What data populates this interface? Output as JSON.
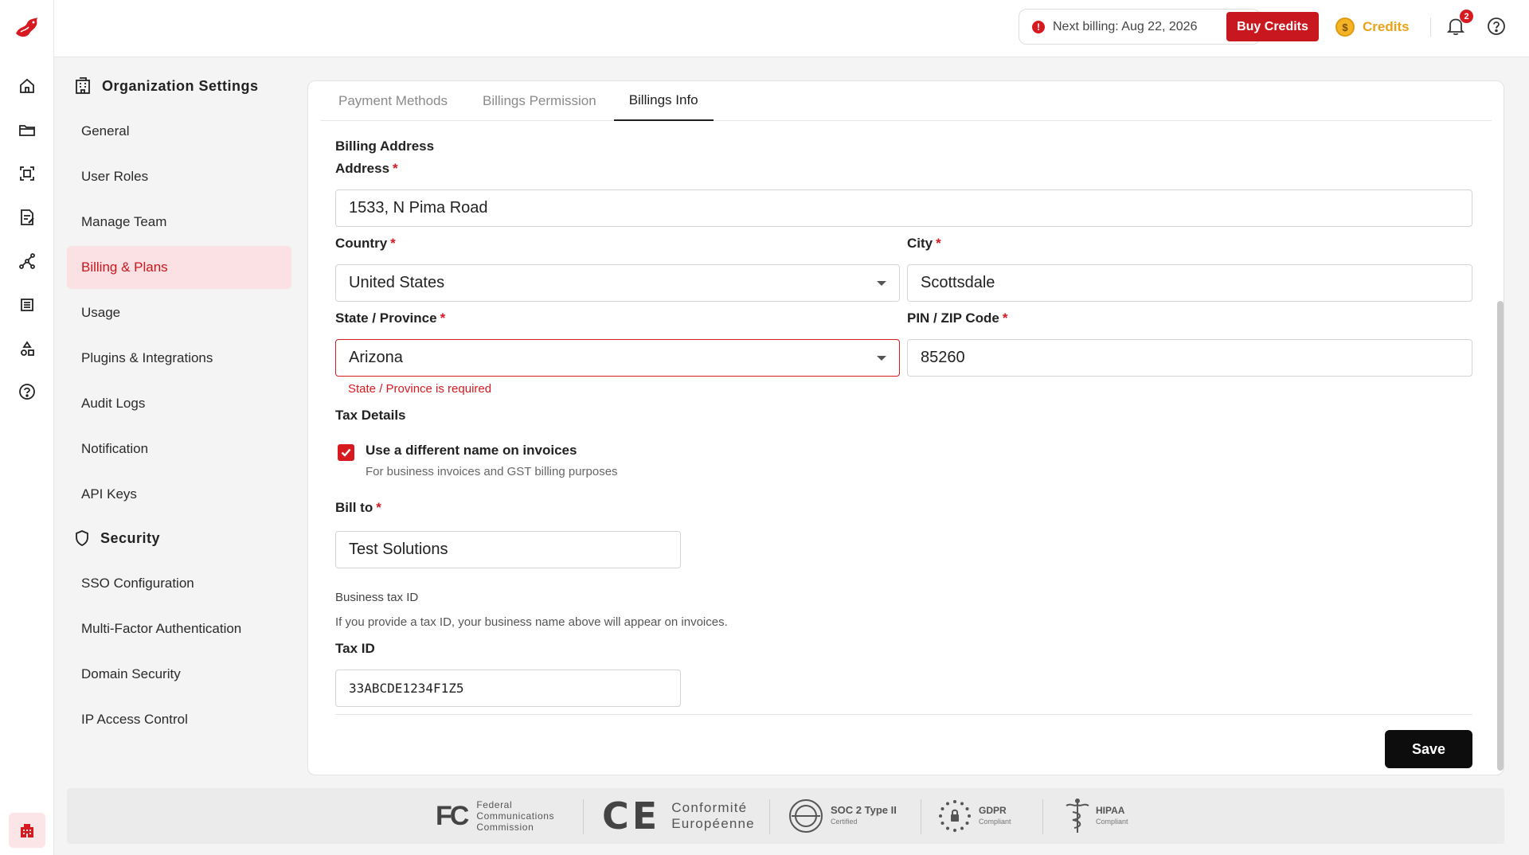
{
  "topbar": {
    "next_billing": "Next billing: Aug 22, 2026",
    "buy_credits": "Buy Credits",
    "credits": "Credits",
    "notification_count": "2",
    "info_symbol": "!",
    "coin_symbol": "$"
  },
  "rail": {
    "icons": [
      "home-icon",
      "folder-icon",
      "scan-icon",
      "document-edit-icon",
      "workflow-icon",
      "table-icon",
      "shapes-icon",
      "help-icon",
      "organization-icon"
    ]
  },
  "menu": {
    "org_heading": "Organization Settings",
    "org_items": [
      "General",
      "User Roles",
      "Manage Team",
      "Billing & Plans",
      "Usage",
      "Plugins & Integrations",
      "Audit Logs",
      "Notification",
      "API Keys"
    ],
    "active_item": "Billing & Plans",
    "security_heading": "Security",
    "security_items": [
      "SSO Configuration",
      "Multi-Factor Authentication",
      "Domain Security",
      "IP Access Control"
    ]
  },
  "tabs": [
    "Payment Methods",
    "Billings Permission",
    "Billings Info"
  ],
  "active_tab": "Billings Info",
  "form": {
    "billing_address_title": "Billing Address",
    "address_label": "Address",
    "address_value": "1533, N Pima Road",
    "country_label": "Country",
    "country_value": "United States",
    "city_label": "City",
    "city_value": "Scottsdale",
    "state_label": "State / Province",
    "state_value": "Arizona",
    "state_error": "State / Province is required",
    "zip_label": "PIN / ZIP Code",
    "zip_value": "85260",
    "required_mark": "*",
    "tax_details_title": "Tax Details",
    "checkbox_label": "Use a different name on invoices",
    "checkbox_checked": true,
    "checkbox_hint": "For business invoices and GST billing purposes",
    "bill_to_label": "Bill to",
    "bill_to_value": "Test Solutions",
    "business_tax_id": "Business tax ID",
    "tax_id_hint": "If you provide a tax ID, your business name above will appear on invoices.",
    "tax_id_label": "Tax ID",
    "tax_id_value": "33ABCDE1234F1Z5",
    "save": "Save"
  },
  "footer": {
    "fcc_logo": "FC",
    "fcc": [
      "Federal",
      "Communications",
      "Commission"
    ],
    "ce_logo": "CE",
    "ce": [
      "Conformité",
      "Européenne"
    ],
    "soc_title": "SOC 2 Type II",
    "soc_sub": "Certified",
    "gdpr_title": "GDPR",
    "gdpr_sub": "Compliant",
    "hipaa_title": "HIPAA",
    "hipaa_sub": "Compliant"
  },
  "colors": {
    "brand_red": "#c8171e",
    "active_bg": "#fbe1e3",
    "credits_gold": "#e8a317",
    "save_black": "#0d0d0d"
  }
}
